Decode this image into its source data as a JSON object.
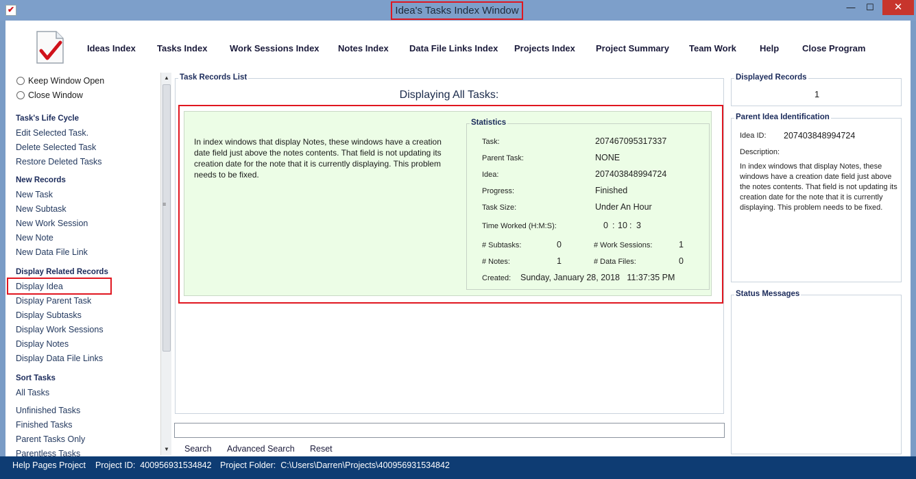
{
  "window": {
    "title": "Idea's Tasks Index Window",
    "minimize": "—",
    "maximize": "☐",
    "close": "✕"
  },
  "menu": [
    "Ideas Index",
    "Tasks Index",
    "Work Sessions Index",
    "Notes Index",
    "Data File Links Index",
    "Projects Index",
    "Project Summary",
    "Team Work",
    "Help",
    "Close Program"
  ],
  "sidebar": {
    "options": [
      "Keep Window Open",
      "Close Window"
    ],
    "lifecycle": {
      "title": "Task's Life Cycle",
      "items": [
        "Edit Selected Task.",
        "Delete Selected Task",
        "Restore Deleted Tasks"
      ]
    },
    "new_records": {
      "title": "New Records",
      "items": [
        "New Task",
        "New Subtask",
        "New Work Session",
        "New Note",
        "New Data File Link"
      ]
    },
    "related": {
      "title": "Display Related Records",
      "items": [
        "Display Idea",
        "Display Parent Task",
        "Display Subtasks",
        "Display Work Sessions",
        "Display Notes",
        "Display Data File Links"
      ]
    },
    "sort": {
      "title": "Sort Tasks",
      "items": [
        "All Tasks",
        "Unfinished Tasks",
        "Finished Tasks",
        "Parent Tasks Only",
        "Parentless Tasks"
      ]
    }
  },
  "main": {
    "group_label": "Task Records List",
    "display_title": "Displaying All Tasks:",
    "record": {
      "note": "In index windows that display Notes, these windows have a creation date field just above the notes contents. That field is not updating its creation date for the note that it is currently displaying. This problem needs to be fixed.",
      "stats_label": "Statistics",
      "labels": {
        "task": "Task:",
        "parent_task": "Parent Task:",
        "idea": "Idea:",
        "progress": "Progress:",
        "task_size": "Task Size:",
        "time_worked": "Time Worked (H:M:S):",
        "subtasks": "# Subtasks:",
        "work_sessions": "# Work Sessions:",
        "notes": "# Notes:",
        "data_files": "# Data Files:",
        "created": "Created:"
      },
      "values": {
        "task": "207467095317337",
        "parent_task": "NONE",
        "idea": "207403848994724",
        "progress": "Finished",
        "task_size": "Under An Hour",
        "time_h": "0",
        "time_sep1": ":",
        "time_m": "10",
        "time_sep2": ":",
        "time_s": "3",
        "subtasks": "0",
        "work_sessions": "1",
        "notes": "1",
        "data_files": "0",
        "created": "Sunday, January 28, 2018   11:37:35 PM"
      }
    },
    "search_buttons": [
      "Search",
      "Advanced Search",
      "Reset"
    ]
  },
  "right": {
    "displayed_label": "Displayed Records",
    "displayed_count": "1",
    "parent_label": "Parent Idea Identification",
    "idea_id_label": "Idea ID:",
    "idea_id_value": "207403848994724",
    "description_label": "Description:",
    "description_text": "In index windows that display Notes, these windows have a creation date field just above the notes contents. That field is not updating its creation date for the note that it is currently displaying. This problem needs to be fixed.",
    "status_label": "Status Messages"
  },
  "statusbar": {
    "project": "Help Pages Project",
    "project_id": "Project ID:  400956931534842",
    "project_folder": "Project Folder:  C:\\Users\\Darren\\Projects\\400956931534842"
  },
  "colors": {
    "title_bar": "#7d9fca",
    "status_bar": "#0e3c73",
    "record_bg": "#ecfde6",
    "highlight": "#e0161f"
  }
}
